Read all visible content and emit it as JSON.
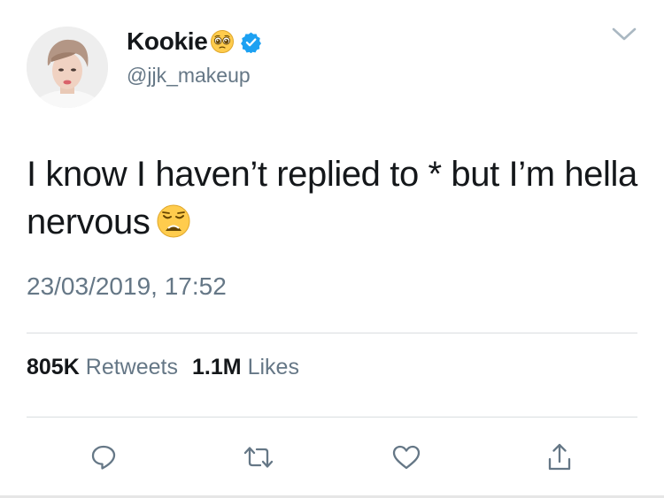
{
  "user": {
    "display_name": "Kookie",
    "handle": "@jjk_makeup",
    "name_emoji": "pleading-face-emoji",
    "verified": true
  },
  "tweet": {
    "text": "I know I haven’t replied to * but I’m hella nervous",
    "trailing_emoji": "weary-face-emoji",
    "timestamp": "23/03/2019, 17:52"
  },
  "stats": {
    "retweets_count": "805K",
    "retweets_label": "Retweets",
    "likes_count": "1.1M",
    "likes_label": "Likes"
  },
  "icons": {
    "more": "chevron-down-icon",
    "reply": "reply-icon",
    "retweet": "retweet-icon",
    "like": "heart-icon",
    "share": "share-icon"
  },
  "colors": {
    "text_primary": "#14171a",
    "text_secondary": "#657786",
    "verified_blue": "#1da1f2",
    "divider": "#d9dde0"
  }
}
